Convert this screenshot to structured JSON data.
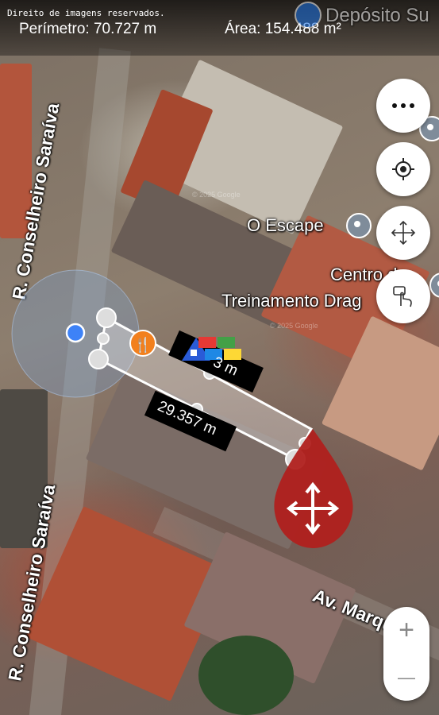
{
  "header": {
    "credit": "Direito de imagens reservados.",
    "perimeter": "Perímetro: 70.727 m",
    "area": "Área: 154.488 m²"
  },
  "map": {
    "streets": [
      "R. Conselheiro Saraíva",
      "R. Conselheiro Saraíva",
      "Av. Marqu"
    ],
    "places": [
      "Depósito Su",
      "O Escape",
      "Centro de",
      "Treinamento Drag"
    ],
    "watermark": "© 2025 Google"
  },
  "measure": {
    "segment_label_1": "3 m",
    "segment_label_2": "29.357 m"
  },
  "controls": {
    "more_icon": "more-horizontal-icon",
    "locate_icon": "crosshair-icon",
    "move_icon": "move-arrows-icon",
    "touch_icon": "touch-hand-icon",
    "zoom_in": "+",
    "zoom_out": "—"
  },
  "colors": {
    "polygon": "#ffffff",
    "handle_pin": "#b0201d",
    "location_dot": "#3d82f7",
    "poi_orange": "#f2801e"
  }
}
